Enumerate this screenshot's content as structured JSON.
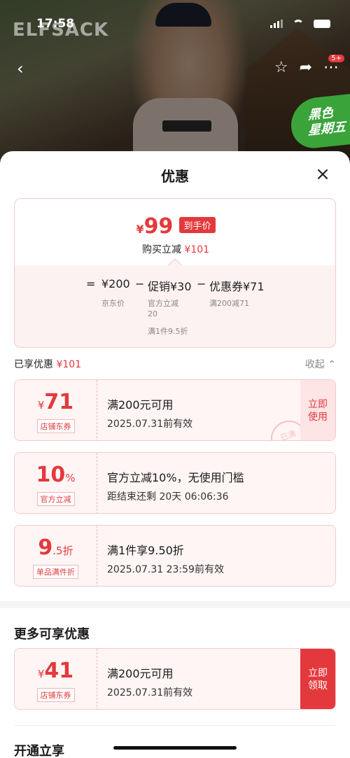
{
  "status_bar": {
    "time": "17:58"
  },
  "backdrop": {
    "brand_text": "ELFSACK",
    "badge_text": "黑色\n星期五",
    "notification_count": "5+"
  },
  "sheet": {
    "title": "优惠",
    "close_symbol": "×"
  },
  "summary": {
    "currency": "¥",
    "final_price": "99",
    "final_tag": "到手价",
    "reduce_label": "购买立减",
    "reduce_value": "¥101",
    "breakdown": {
      "equals": "=",
      "jd_price": "¥200",
      "jd_price_label": "京东价",
      "minus": "−",
      "promo": "促销¥30",
      "promo_sub1": "官方立减",
      "promo_sub2": "20",
      "promo_sub3": "满1件9.5折",
      "coupon": "优惠券¥71",
      "coupon_sub": "满200减71"
    }
  },
  "enjoyed": {
    "label": "已享优惠",
    "value": "¥101",
    "collapse_label": "收起"
  },
  "coupons": [
    {
      "amount_prefix": "¥",
      "amount": "71",
      "amount_suffix": "",
      "tag": "店铺东券",
      "title": "满200元可用",
      "subtitle": "2025.07.31前有效",
      "button": "立即\n使用",
      "stamp": "已满"
    },
    {
      "amount_prefix": "",
      "amount": "10",
      "amount_suffix": "%",
      "tag": "官方立减",
      "title": "官方立减10%，无使用门槛",
      "subtitle": "距结束还剩 20天 06:06:36"
    },
    {
      "amount_prefix": "",
      "amount": "9",
      "amount_suffix": ".5折",
      "tag": "单品满件折",
      "title": "满1件享9.50折",
      "subtitle": "2025.07.31 23:59前有效"
    }
  ],
  "more": {
    "title": "更多可享优惠",
    "coupon": {
      "amount_prefix": "¥",
      "amount": "41",
      "tag": "店铺东券",
      "title": "满200元可用",
      "subtitle": "2025.07.31前有效",
      "button": "立即\n领取"
    }
  },
  "open_share": {
    "title": "开通立享"
  },
  "colors": {
    "accent": "#e4393c",
    "light_pink": "#fff5f5",
    "border_pink": "#f5c9cb"
  }
}
